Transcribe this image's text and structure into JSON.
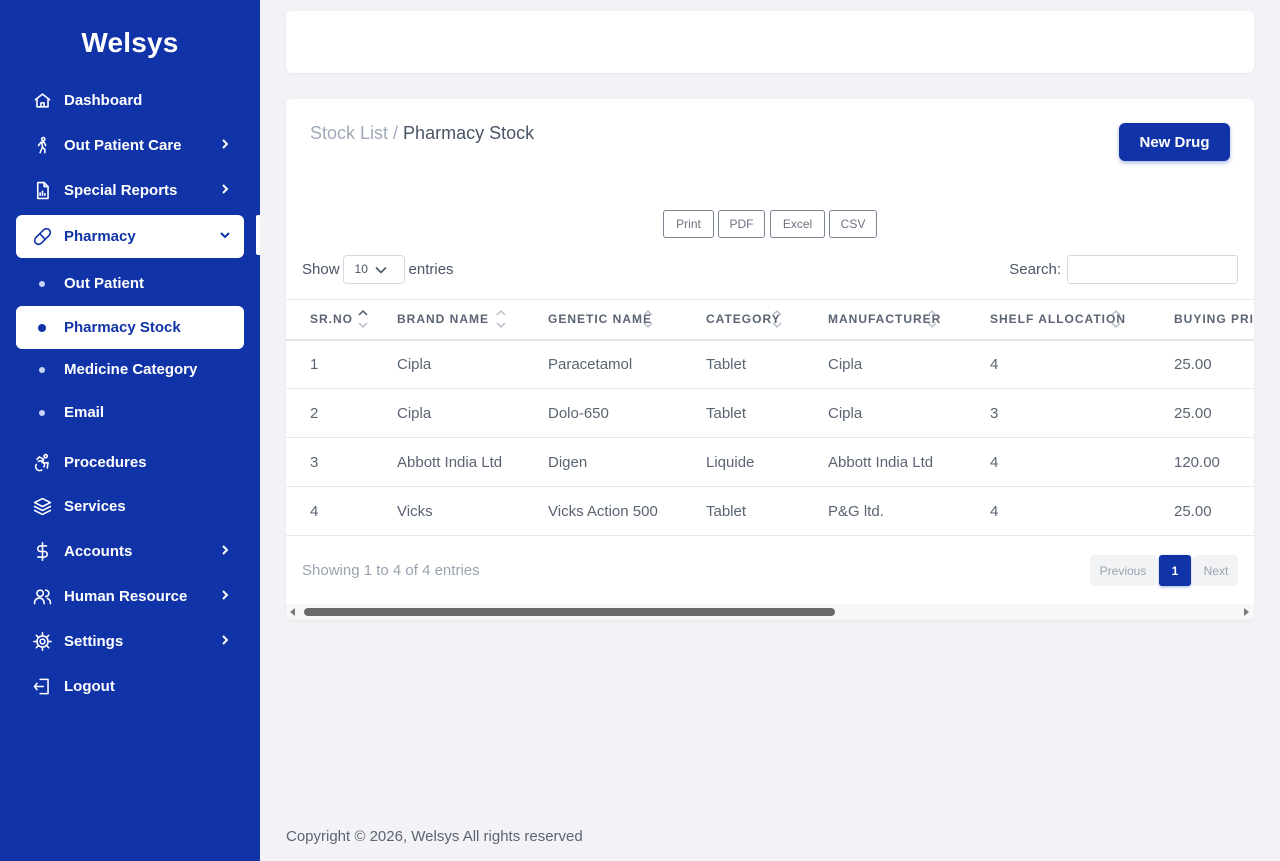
{
  "brand": "Welsys",
  "sidebar": {
    "items": [
      {
        "label": "Dashboard",
        "icon": "home-icon"
      },
      {
        "label": "Out Patient Care",
        "icon": "walking-person-icon"
      },
      {
        "label": "Special Reports",
        "icon": "report-icon"
      },
      {
        "label": "Pharmacy",
        "icon": "pill-icon"
      },
      {
        "label": "Procedures",
        "icon": "accessibility-icon"
      },
      {
        "label": "Services",
        "icon": "layers-icon"
      },
      {
        "label": "Accounts",
        "icon": "dollar-icon"
      },
      {
        "label": "Human Resource",
        "icon": "users-icon"
      },
      {
        "label": "Settings",
        "icon": "gear-icon"
      },
      {
        "label": "Logout",
        "icon": "logout-icon"
      }
    ],
    "pharmacy_sub": [
      {
        "label": "Out Patient"
      },
      {
        "label": "Pharmacy Stock"
      },
      {
        "label": "Medicine Category"
      },
      {
        "label": "Email"
      }
    ]
  },
  "breadcrumb": {
    "parent": "Stock List /",
    "current": "Pharmacy Stock"
  },
  "new_drug_label": "New Drug",
  "export": {
    "print": "Print",
    "pdf": "PDF",
    "excel": "Excel",
    "csv": "CSV"
  },
  "length_menu": {
    "show": "Show",
    "value": "10",
    "entries": "entries"
  },
  "search_label": "Search:",
  "table": {
    "headers": [
      "SR.NO",
      "BRAND NAME",
      "GENETIC NAME",
      "CATEGORY",
      "MANUFACTURER",
      "SHELF ALLOCATION",
      "BUYING PRICE"
    ],
    "rows": [
      [
        "1",
        "Cipla",
        "Paracetamol",
        "Tablet",
        "Cipla",
        "4",
        "25.00"
      ],
      [
        "2",
        "Cipla",
        "Dolo-650",
        "Tablet",
        "Cipla",
        "3",
        "25.00"
      ],
      [
        "3",
        "Abbott India Ltd",
        "Digen",
        "Liquide",
        "Abbott India Ltd",
        "4",
        "120.00"
      ],
      [
        "4",
        "Vicks",
        "Vicks Action 500",
        "Tablet",
        "P&G ltd.",
        "4",
        "25.00"
      ]
    ]
  },
  "info": "Showing 1 to 4 of 4 entries",
  "pagination": {
    "previous": "Previous",
    "current": "1",
    "next": "Next"
  },
  "footer": "Copyright © 2026, Welsys All rights reserved",
  "colors": {
    "primary": "#1033a8",
    "background": "#f3f3f7"
  }
}
